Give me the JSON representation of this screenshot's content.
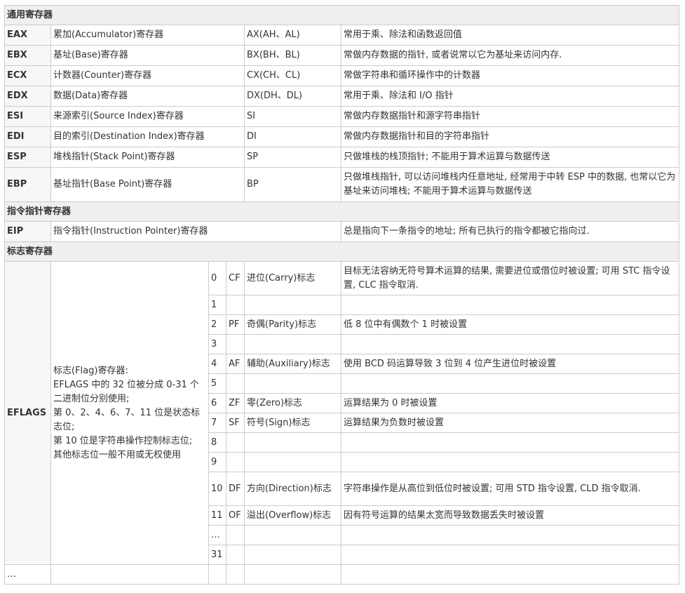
{
  "sections": {
    "general": "通用寄存器",
    "pointer": "指令指针寄存器",
    "flags": "标志寄存器"
  },
  "general": [
    {
      "reg": "EAX",
      "name": "累加(Accumulator)寄存器",
      "sub": "AX(AH、AL)",
      "desc": "常用于乘、除法和函数返回值"
    },
    {
      "reg": "EBX",
      "name": "基址(Base)寄存器",
      "sub": "BX(BH、BL)",
      "desc": "常做内存数据的指针, 或者说常以它为基址来访问内存."
    },
    {
      "reg": "ECX",
      "name": "计数器(Counter)寄存器",
      "sub": "CX(CH、CL)",
      "desc": "常做字符串和循环操作中的计数器"
    },
    {
      "reg": "EDX",
      "name": "数据(Data)寄存器",
      "sub": "DX(DH、DL)",
      "desc": "常用于乘、除法和 I/O 指针"
    },
    {
      "reg": "ESI",
      "name": "来源索引(Source Index)寄存器",
      "sub": "SI",
      "desc": "常做内存数据指针和源字符串指针"
    },
    {
      "reg": "EDI",
      "name": "目的索引(Destination Index)寄存器",
      "sub": "DI",
      "desc": "常做内存数据指针和目的字符串指针"
    },
    {
      "reg": "ESP",
      "name": "堆栈指针(Stack Point)寄存器",
      "sub": "SP",
      "desc": "只做堆栈的栈顶指针; 不能用于算术运算与数据传送"
    },
    {
      "reg": "EBP",
      "name": "基址指针(Base Point)寄存器",
      "sub": "BP",
      "desc": "只做堆栈指针, 可以访问堆栈内任意地址, 经常用于中转 ESP 中的数据, 也常以它为基址来访问堆栈; 不能用于算术运算与数据传送"
    }
  ],
  "eip": {
    "reg": "EIP",
    "name": "指令指针(Instruction Pointer)寄存器",
    "desc": "总是指向下一条指令的地址; 所有已执行的指令都被它指向过."
  },
  "eflags": {
    "reg": "EFLAGS",
    "desc_lines": [
      "标志(Flag)寄存器:",
      "EFLAGS 中的 32 位被分成 0-31 个二进制位分别使用;",
      "第 0、2、4、6、7、11 位是状态标志位;",
      "第 10 位是字符串操作控制标志位;",
      "其他标志位一般不用或无权使用"
    ],
    "bits": [
      {
        "bit": "0",
        "abbr": "CF",
        "name": "进位(Carry)标志",
        "desc": "目标无法容纳无符号算术运算的结果, 需要进位或借位时被设置; 可用 STC 指令设置, CLC 指令取消."
      },
      {
        "bit": "1",
        "abbr": "",
        "name": "",
        "desc": ""
      },
      {
        "bit": "2",
        "abbr": "PF",
        "name": "奇偶(Parity)标志",
        "desc": "低 8 位中有偶数个 1 时被设置"
      },
      {
        "bit": "3",
        "abbr": "",
        "name": "",
        "desc": ""
      },
      {
        "bit": "4",
        "abbr": "AF",
        "name": "辅助(Auxiliary)标志",
        "desc": "使用 BCD 码运算导致 3 位到 4 位产生进位时被设置"
      },
      {
        "bit": "5",
        "abbr": "",
        "name": "",
        "desc": ""
      },
      {
        "bit": "6",
        "abbr": "ZF",
        "name": "零(Zero)标志",
        "desc": "运算结果为 0 时被设置"
      },
      {
        "bit": "7",
        "abbr": "SF",
        "name": "符号(Sign)标志",
        "desc": "运算结果为负数时被设置"
      },
      {
        "bit": "8",
        "abbr": "",
        "name": "",
        "desc": ""
      },
      {
        "bit": "9",
        "abbr": "",
        "name": "",
        "desc": ""
      },
      {
        "bit": "10",
        "abbr": "DF",
        "name": "方向(Direction)标志",
        "desc": "字符串操作是从高位到低位时被设置; 可用 STD 指令设置, CLD 指令取消."
      },
      {
        "bit": "11",
        "abbr": "OF",
        "name": "溢出(Overflow)标志",
        "desc": "因有符号运算的结果太宽而导致数据丢失时被设置"
      },
      {
        "bit": "…",
        "abbr": "",
        "name": "",
        "desc": ""
      },
      {
        "bit": "31",
        "abbr": "",
        "name": "",
        "desc": ""
      }
    ]
  },
  "last_row": {
    "reg": "…"
  }
}
